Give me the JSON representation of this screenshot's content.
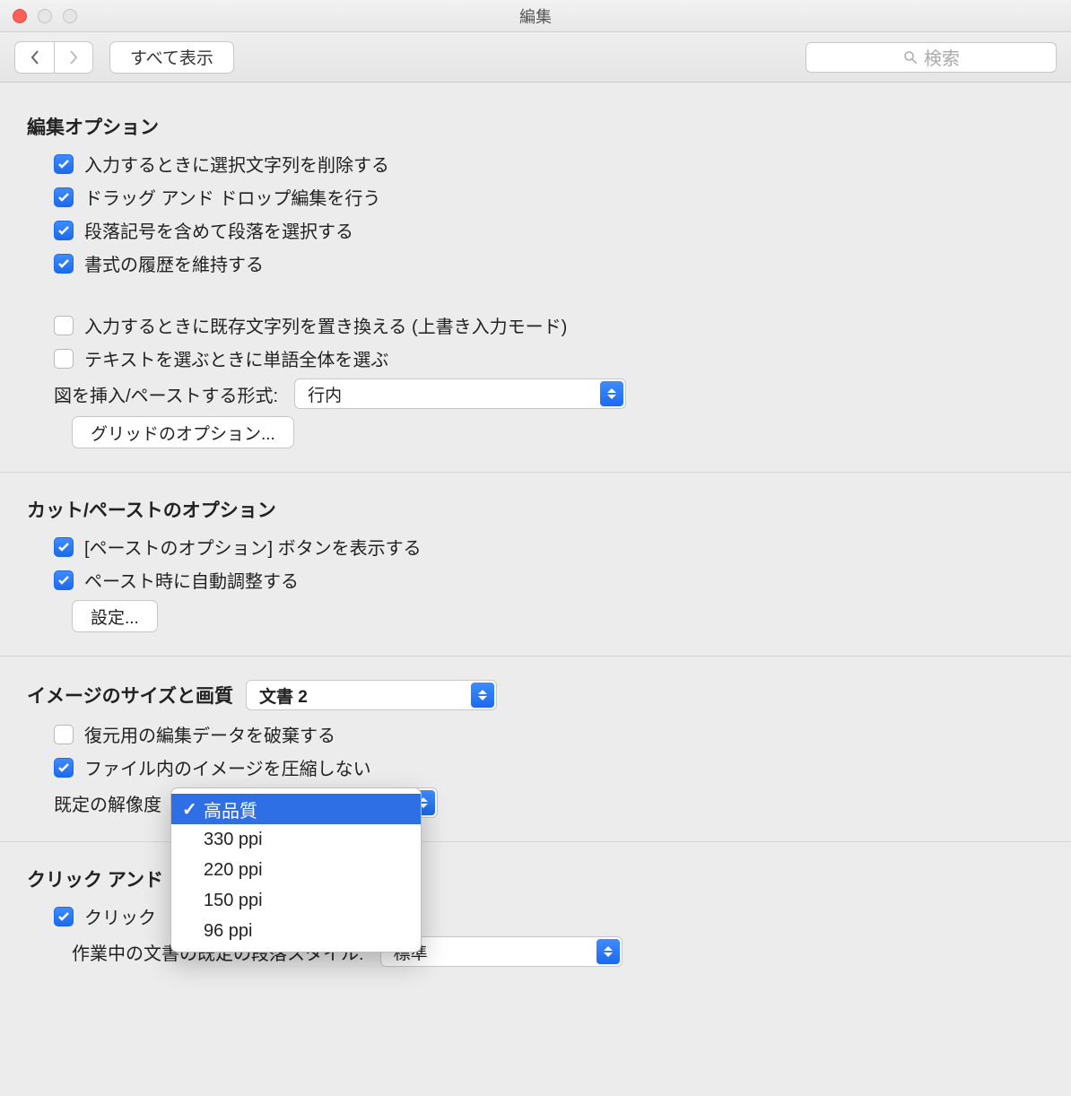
{
  "window": {
    "title": "編集"
  },
  "toolbar": {
    "show_all": "すべて表示",
    "search_placeholder": "検索"
  },
  "sections": {
    "editing_options": {
      "title": "編集オプション",
      "opt1": "入力するときに選択文字列を削除する",
      "opt2": "ドラッグ アンド ドロップ編集を行う",
      "opt3": "段落記号を含めて段落を選択する",
      "opt4": "書式の履歴を維持する",
      "opt5": "入力するときに既存文字列を置き換える (上書き入力モード)",
      "opt6": "テキストを選ぶときに単語全体を選ぶ",
      "insert_paste_label": "図を挿入/ペーストする形式:",
      "insert_paste_value": "行内",
      "grid_options_btn": "グリッドのオプション..."
    },
    "cut_paste": {
      "title": "カット/ペーストのオプション",
      "opt1": "[ペーストのオプション] ボタンを表示する",
      "opt2": "ペースト時に自動調整する",
      "settings_btn": "設定..."
    },
    "image_size": {
      "title": "イメージのサイズと画質",
      "doc_select": "文書 2",
      "opt1": "復元用の編集データを破棄する",
      "opt2": "ファイル内のイメージを圧縮しない",
      "default_res_label": "既定の解像度",
      "resolution_menu": {
        "selected": "高品質",
        "items": [
          "高品質",
          "330 ppi",
          "220 ppi",
          "150 ppi",
          "96 ppi"
        ]
      }
    },
    "click_and": {
      "title_visible": "クリック アンド",
      "opt1_visible": "クリック",
      "para_style_label_visible": "作業中の文書の既定の段落スタイル:",
      "para_style_value": "標準"
    }
  }
}
